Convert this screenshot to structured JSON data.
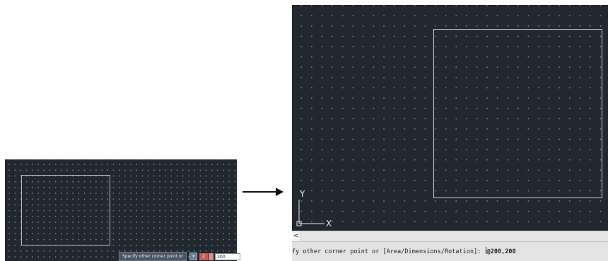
{
  "left_panel": {
    "tooltip_prompt": "Specify other corner point or",
    "down_arrow_icon": "down-arrow",
    "field_a_value": "2",
    "field_b_value": "200"
  },
  "arrow_icon": "right-arrow",
  "right_panel": {
    "axis_y_label": "Y",
    "axis_x_label": "X",
    "scroll_left_glyph": "<",
    "command_prompt": "fy other corner point or [Area/Dimensions/Rotation]: ",
    "command_input": "@200,200"
  },
  "colors": {
    "canvas_bg": "#212830",
    "rectangle_stroke": "#c9ced4",
    "command_bar": "#e3e3e3"
  }
}
